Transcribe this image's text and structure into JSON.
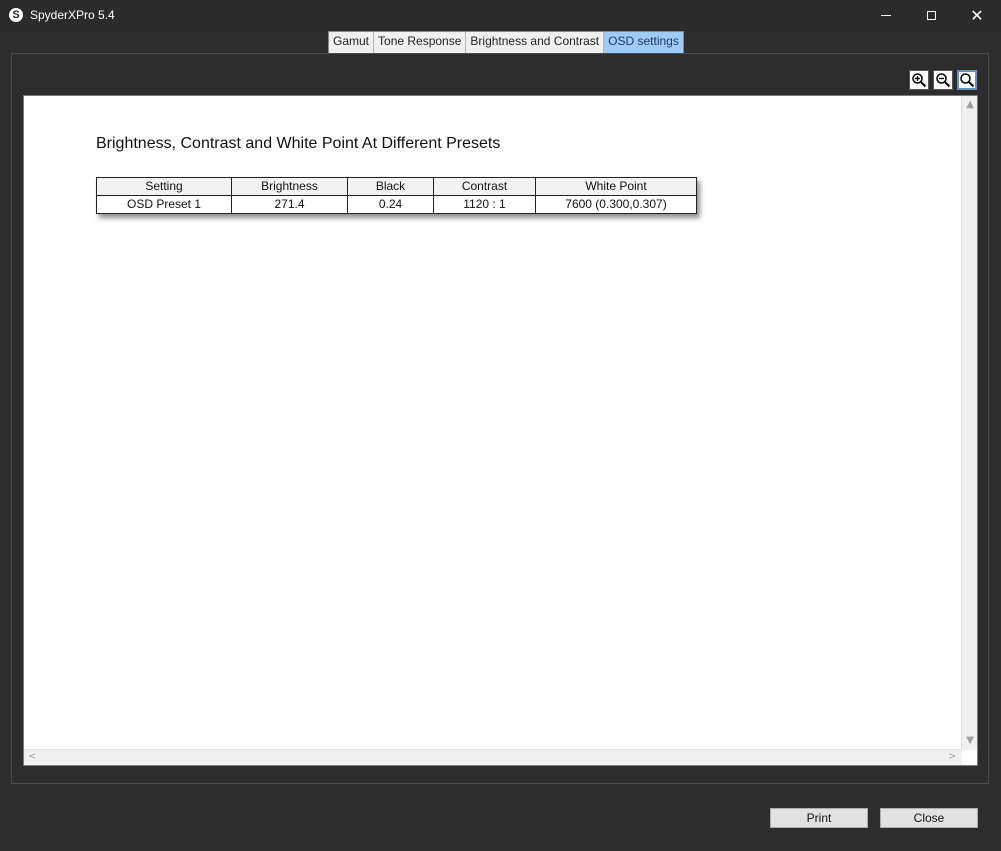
{
  "window": {
    "title": "SpyderXPro 5.4",
    "icon_glyph": "S",
    "close_glyph": "✕"
  },
  "tabs": [
    {
      "label": "Gamut",
      "active": false
    },
    {
      "label": "Tone Response",
      "active": false
    },
    {
      "label": "Brightness and Contrast",
      "active": false
    },
    {
      "label": "OSD settings",
      "active": true
    }
  ],
  "toolbar": {
    "icons": [
      "zoom-in-icon",
      "zoom-out-icon",
      "zoom-fit-icon"
    ]
  },
  "report": {
    "title": "Brightness, Contrast and White Point At Different Presets",
    "table": {
      "headers": [
        "Setting",
        "Brightness",
        "Black",
        "Contrast",
        "White Point"
      ],
      "rows": [
        [
          "OSD Preset 1",
          "271.4",
          "0.24",
          "1120 : 1",
          "7600 (0.300,0.307)"
        ]
      ]
    }
  },
  "scroll": {
    "up": "▲",
    "down": "▼",
    "left": "<",
    "right": ">"
  },
  "buttons": {
    "print": "Print",
    "close": "Close"
  },
  "colors": {
    "active_tab": "#9fcbf7",
    "window_bg": "#2d2d2d"
  }
}
